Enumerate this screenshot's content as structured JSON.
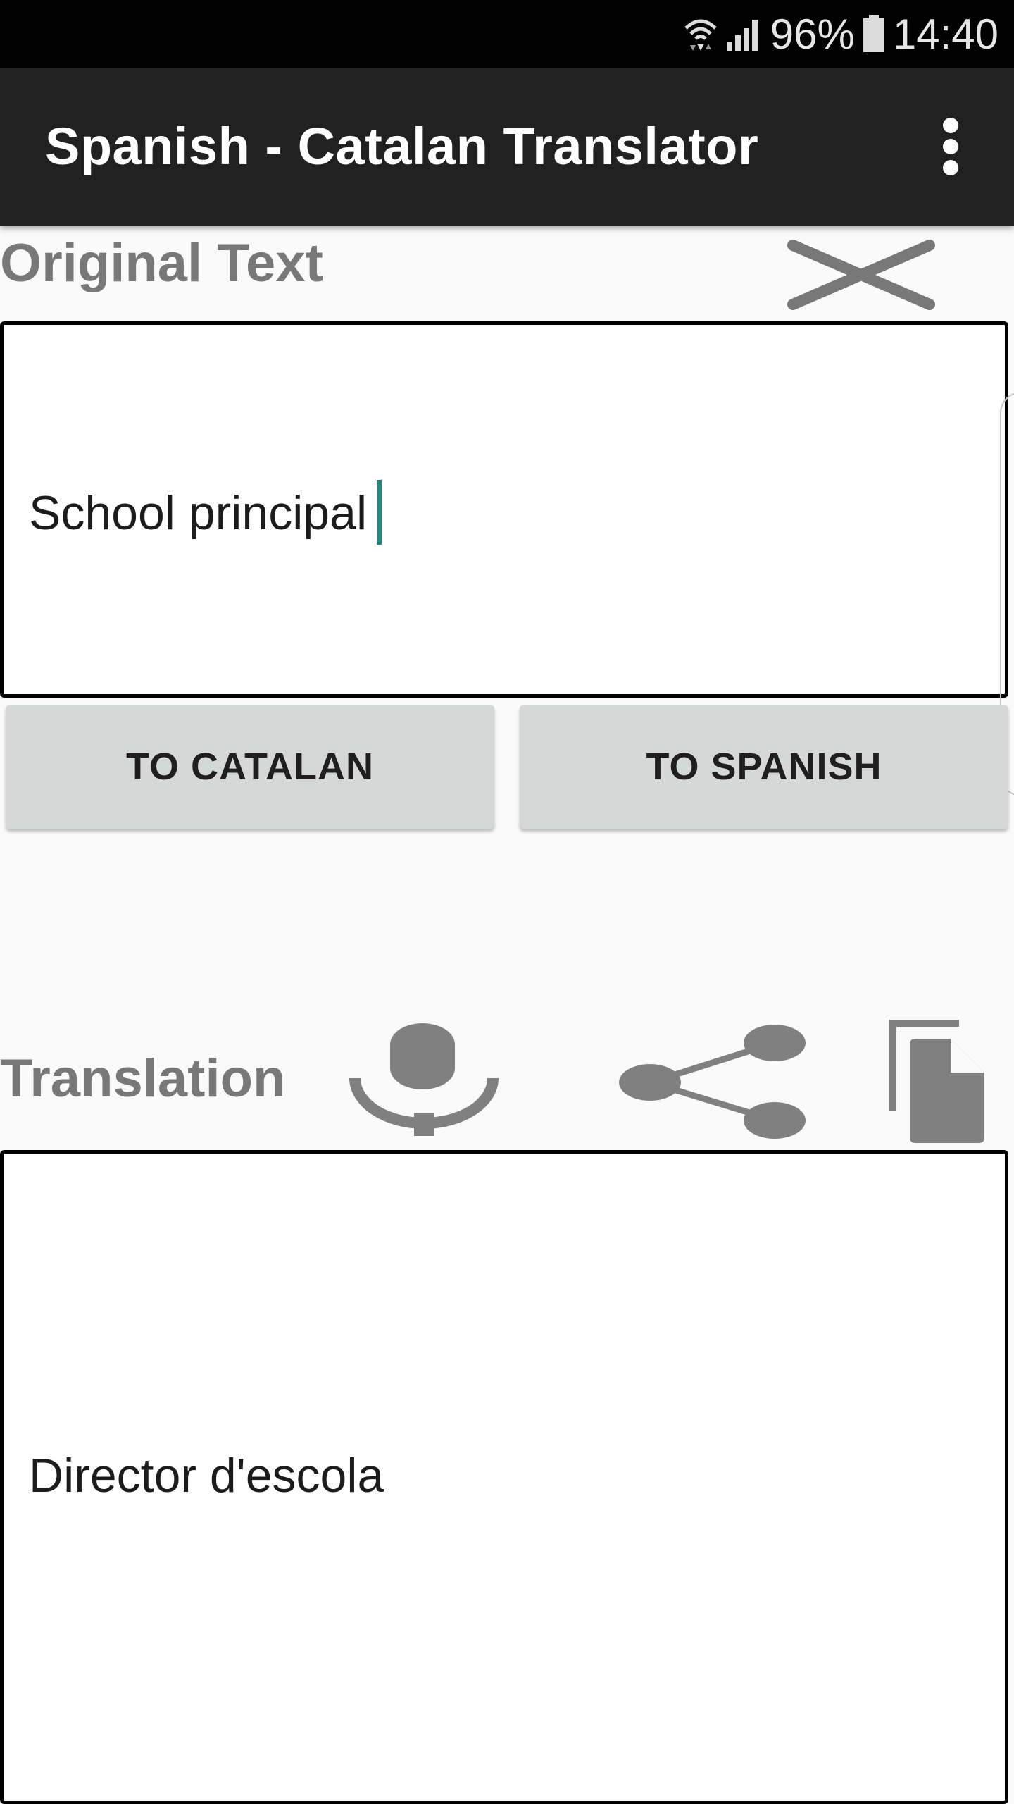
{
  "status_bar": {
    "battery": "96%",
    "time": "14:40"
  },
  "app_bar": {
    "title": "Spanish - Catalan Translator"
  },
  "original": {
    "label": "Original Text",
    "input_value": "School principal"
  },
  "buttons": {
    "to_catalan": "TO CATALAN",
    "to_spanish": "TO SPANISH"
  },
  "translation": {
    "label": "Translation",
    "output_value": "Director d'escola"
  },
  "icons": {
    "wifi": "wifi-icon",
    "signal": "signal-icon",
    "battery": "battery-icon",
    "overflow": "more-vert-icon",
    "clear": "clear-icon",
    "mic": "microphone-icon",
    "share": "share-icon",
    "copy": "copy-icon"
  },
  "colors": {
    "app_bar": "#212121",
    "label_gray": "#787878",
    "button_bg": "#d6d7d7",
    "cursor": "#1f8a80"
  }
}
